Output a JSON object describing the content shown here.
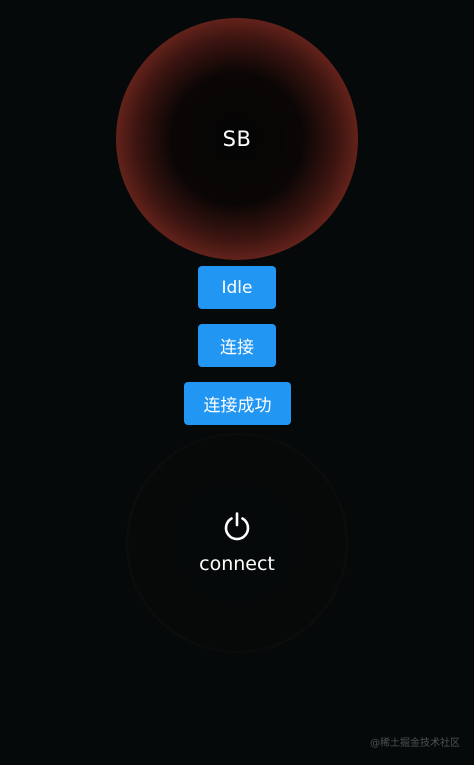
{
  "status_orb": {
    "label": "SB"
  },
  "buttons": {
    "idle": "Idle",
    "connect": "连接",
    "connect_success": "连接成功"
  },
  "power_button": {
    "icon": "power-icon",
    "label": "connect"
  },
  "watermark": "@稀土掘金技术社区",
  "colors": {
    "background": "#060909",
    "button": "#2196f3",
    "orb_edge": "#b3392e",
    "text": "#ffffff"
  }
}
